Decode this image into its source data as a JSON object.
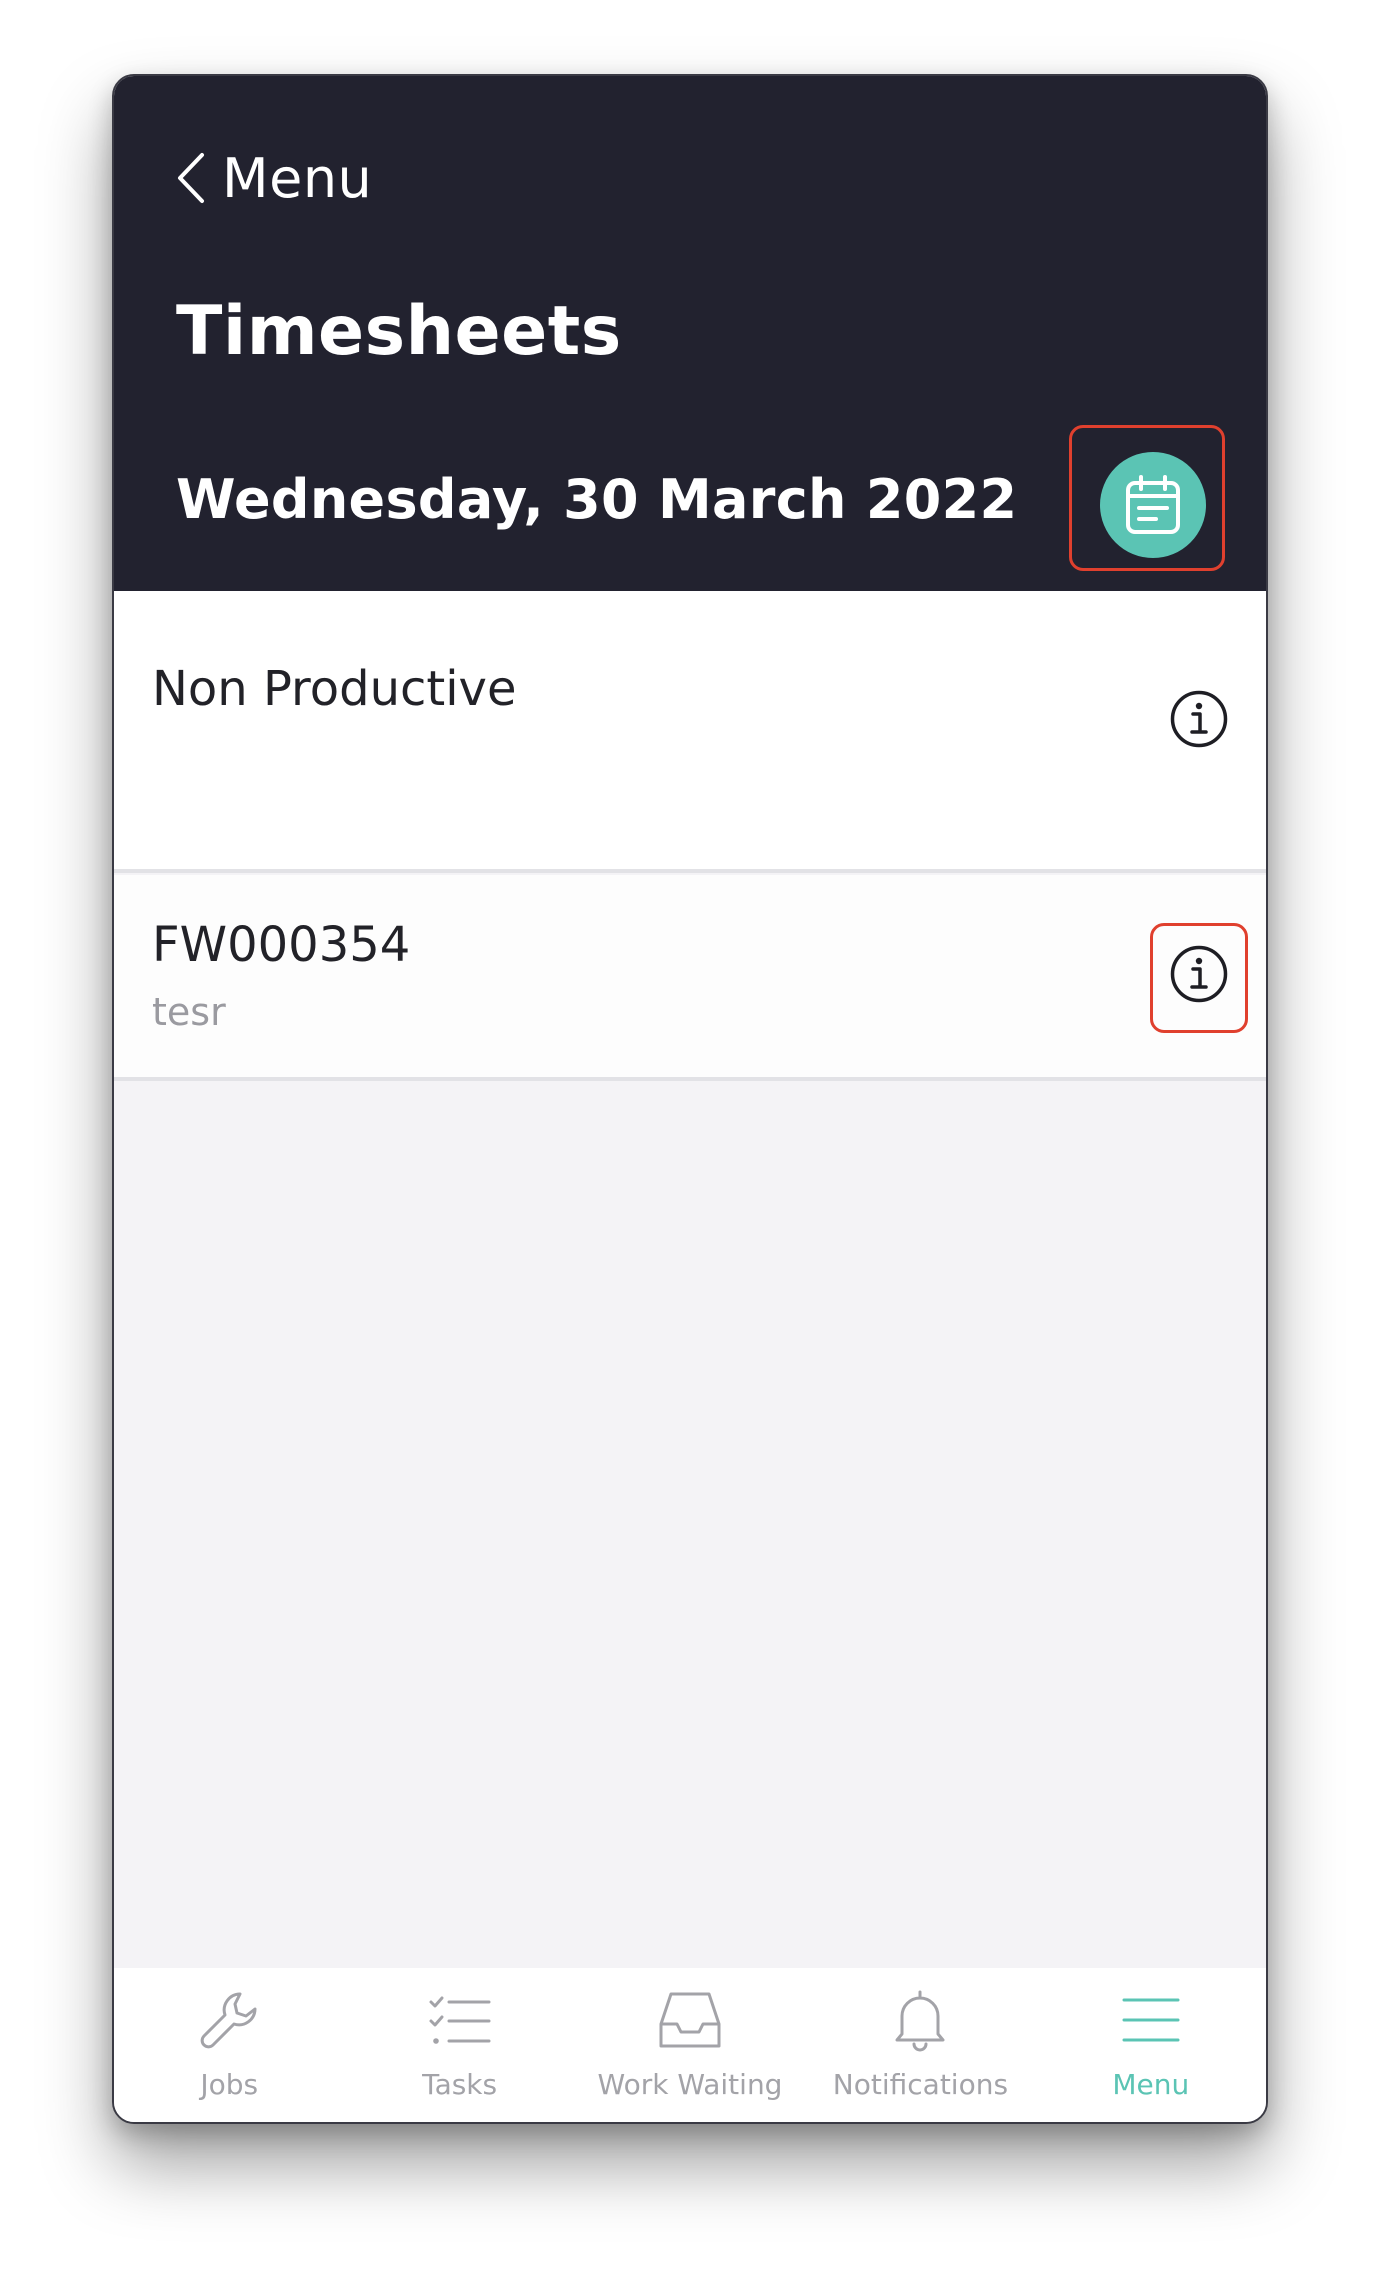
{
  "header": {
    "back_label": "Menu",
    "title": "Timesheets",
    "date": "Wednesday, 30 March 2022",
    "calendar_icon": "calendar-icon",
    "accent_color": "#5bc4b4",
    "background_color": "#22222f"
  },
  "entries": [
    {
      "title": "Non Productive",
      "subtitle": "",
      "icon": "info-icon"
    },
    {
      "title": "FW000354",
      "subtitle": "tesr",
      "icon": "info-icon"
    }
  ],
  "tabbar": {
    "items": [
      {
        "label": "Jobs",
        "icon": "wrench-icon",
        "active": false
      },
      {
        "label": "Tasks",
        "icon": "checklist-icon",
        "active": false
      },
      {
        "label": "Work Waiting",
        "icon": "inbox-icon",
        "active": false
      },
      {
        "label": "Notifications",
        "icon": "bell-icon",
        "active": false
      },
      {
        "label": "Menu",
        "icon": "hamburger-icon",
        "active": true
      }
    ],
    "inactive_color": "#a3a3a8",
    "active_color": "#5bc4b4"
  }
}
